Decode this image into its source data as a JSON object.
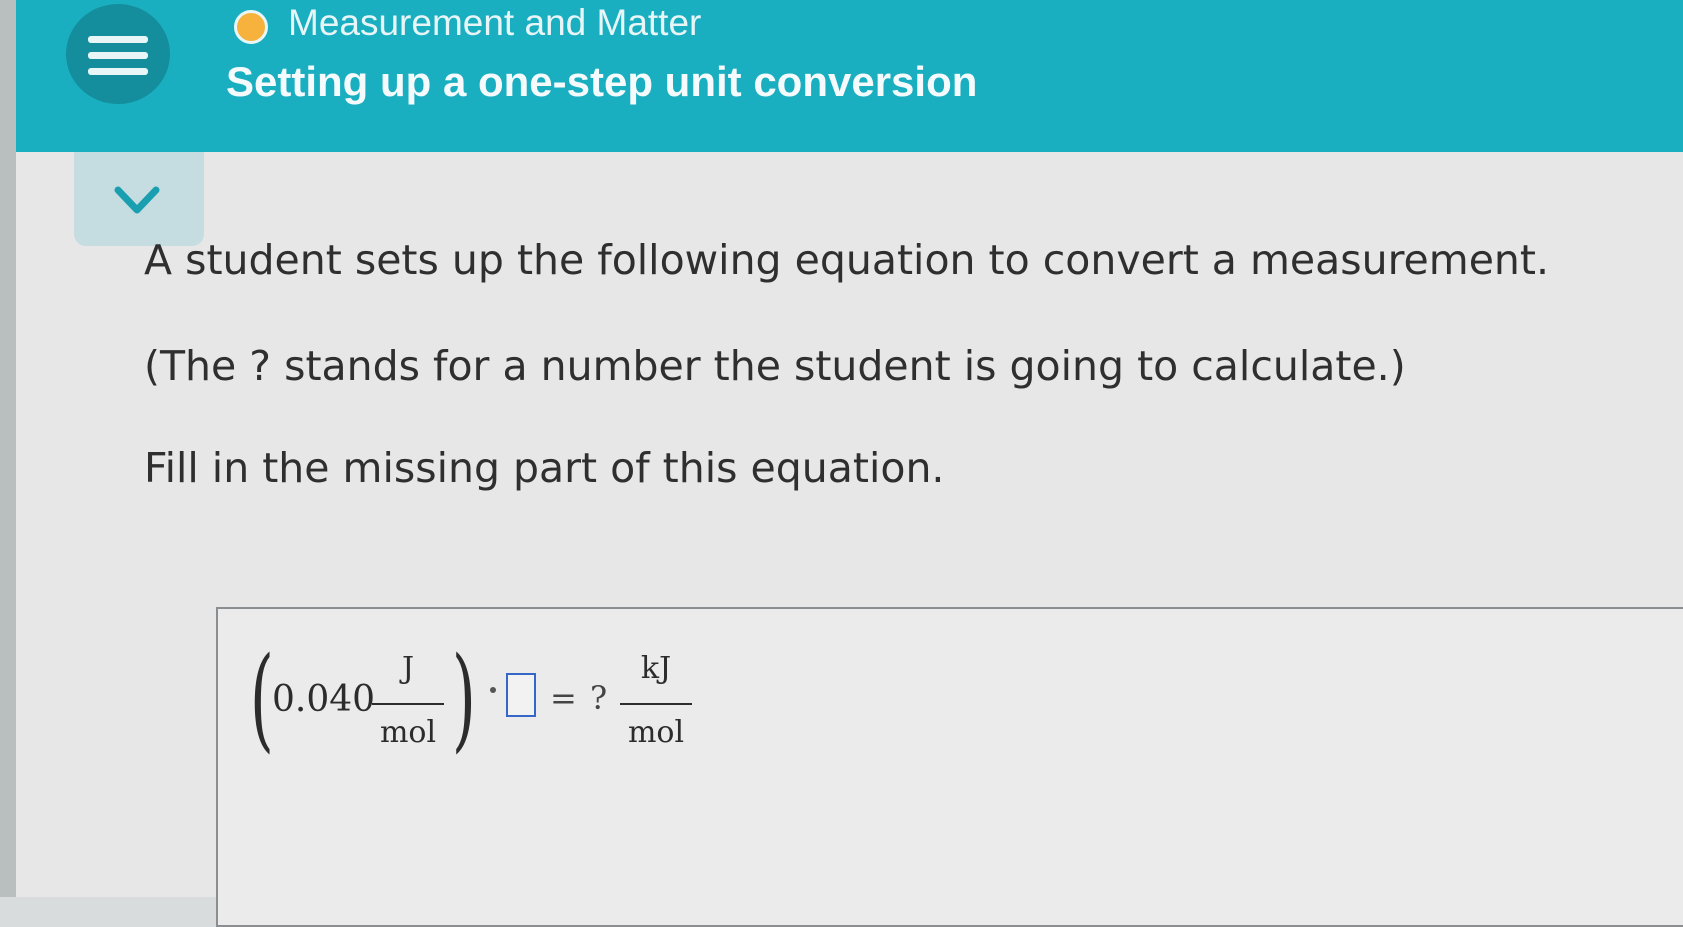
{
  "header": {
    "topic": "Measurement and Matter",
    "title": "Setting up a one-step unit conversion",
    "status_color": "#f6b23c",
    "menu_icon": "hamburger-menu-icon"
  },
  "collapse": {
    "icon": "chevron-down-icon"
  },
  "question": {
    "line1": "A student sets up the following equation to convert a measurement.",
    "line2": "(The ? stands for a number the student is going to calculate.)",
    "line3": "Fill in the missing part of this equation."
  },
  "equation": {
    "value": "0.040",
    "left_numerator": "J",
    "left_denominator": "mol",
    "multiply": "·",
    "equals": "=",
    "unknown": "?",
    "right_numerator": "kJ",
    "right_denominator": "mol"
  },
  "colors": {
    "header_bg": "#1aafc0",
    "input_border": "#3467c8"
  }
}
